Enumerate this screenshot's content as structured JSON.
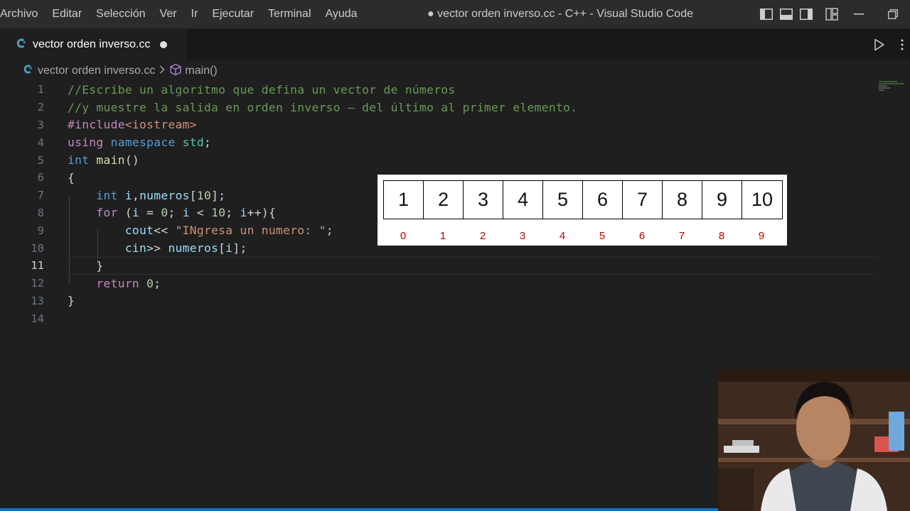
{
  "menu": [
    "Archivo",
    "Editar",
    "Selección",
    "Ver",
    "Ir",
    "Ejecutar",
    "Terminal",
    "Ayuda"
  ],
  "window_title": "● vector orden inverso.cc - C++ - Visual Studio Code",
  "tab": {
    "label": "vector orden inverso.cc",
    "modified": true
  },
  "breadcrumb": {
    "file": "vector orden inverso.cc",
    "symbol": "main()"
  },
  "editor": {
    "active_line": 11,
    "line_numbers": [
      "1",
      "2",
      "3",
      "4",
      "5",
      "6",
      "7",
      "8",
      "9",
      "10",
      "11",
      "12",
      "13",
      "14"
    ],
    "lines": [
      [
        {
          "t": "//Escribe un algoritmo que defina un vector de números",
          "c": "c-comment"
        }
      ],
      [
        {
          "t": "//y muestre la salida en orden inverso — del último al primer elemento.",
          "c": "c-comment"
        }
      ],
      [
        {
          "t": "#include",
          "c": "c-pp"
        },
        {
          "t": "<iostream>",
          "c": "c-inc"
        }
      ],
      [
        {
          "t": "using",
          "c": "c-ctl"
        },
        {
          "t": " ",
          "c": "c-plain"
        },
        {
          "t": "namespace",
          "c": "c-kw"
        },
        {
          "t": " ",
          "c": "c-plain"
        },
        {
          "t": "std",
          "c": "c-type"
        },
        {
          "t": ";",
          "c": "c-plain"
        }
      ],
      [
        {
          "t": "int",
          "c": "c-kw"
        },
        {
          "t": " ",
          "c": "c-plain"
        },
        {
          "t": "main",
          "c": "c-fn"
        },
        {
          "t": "()",
          "c": "c-plain"
        }
      ],
      [
        {
          "t": "{",
          "c": "c-plain"
        }
      ],
      [
        {
          "t": "    ",
          "c": "c-plain"
        },
        {
          "t": "int",
          "c": "c-kw"
        },
        {
          "t": " ",
          "c": "c-plain"
        },
        {
          "t": "i",
          "c": "c-var"
        },
        {
          "t": ",",
          "c": "c-plain"
        },
        {
          "t": "numeros",
          "c": "c-var"
        },
        {
          "t": "[",
          "c": "c-plain"
        },
        {
          "t": "10",
          "c": "c-num"
        },
        {
          "t": "];",
          "c": "c-plain"
        }
      ],
      [
        {
          "t": "    ",
          "c": "c-plain"
        },
        {
          "t": "for",
          "c": "c-ctl"
        },
        {
          "t": " (",
          "c": "c-plain"
        },
        {
          "t": "i",
          "c": "c-var"
        },
        {
          "t": " = ",
          "c": "c-plain"
        },
        {
          "t": "0",
          "c": "c-num"
        },
        {
          "t": "; ",
          "c": "c-plain"
        },
        {
          "t": "i",
          "c": "c-var"
        },
        {
          "t": " < ",
          "c": "c-plain"
        },
        {
          "t": "10",
          "c": "c-num"
        },
        {
          "t": "; ",
          "c": "c-plain"
        },
        {
          "t": "i",
          "c": "c-var"
        },
        {
          "t": "++){",
          "c": "c-plain"
        }
      ],
      [
        {
          "t": "        ",
          "c": "c-plain"
        },
        {
          "t": "cout",
          "c": "c-var"
        },
        {
          "t": "<< ",
          "c": "c-plain"
        },
        {
          "t": "\"INgresa un numero: \"",
          "c": "c-str"
        },
        {
          "t": ";",
          "c": "c-plain"
        }
      ],
      [
        {
          "t": "        ",
          "c": "c-plain"
        },
        {
          "t": "cin",
          "c": "c-var"
        },
        {
          "t": ">> ",
          "c": "c-plain"
        },
        {
          "t": "numeros",
          "c": "c-var"
        },
        {
          "t": "[",
          "c": "c-plain"
        },
        {
          "t": "i",
          "c": "c-var"
        },
        {
          "t": "];",
          "c": "c-plain"
        }
      ],
      [
        {
          "t": "    ",
          "c": "c-plain"
        },
        {
          "t": "}",
          "c": "c-plain"
        }
      ],
      [
        {
          "t": "    ",
          "c": "c-plain"
        },
        {
          "t": "return",
          "c": "c-ctl"
        },
        {
          "t": " ",
          "c": "c-plain"
        },
        {
          "t": "0",
          "c": "c-num"
        },
        {
          "t": ";",
          "c": "c-plain"
        }
      ],
      [
        {
          "t": "}",
          "c": "c-plain"
        }
      ],
      []
    ]
  },
  "array_diagram": {
    "values": [
      "1",
      "2",
      "3",
      "4",
      "5",
      "6",
      "7",
      "8",
      "9",
      "10"
    ],
    "indices": [
      "0",
      "1",
      "2",
      "3",
      "4",
      "5",
      "6",
      "7",
      "8",
      "9"
    ],
    "index_color": "#c00000"
  },
  "colors": {
    "titlebar": "#2c2c2c",
    "editor_bg": "#1f1f1f",
    "accent": "#0e6fbf"
  },
  "icons": {
    "file": "cpp-file-icon",
    "symbol": "cube-method-icon",
    "run": "play-icon",
    "more": "ellipsis-icon"
  }
}
